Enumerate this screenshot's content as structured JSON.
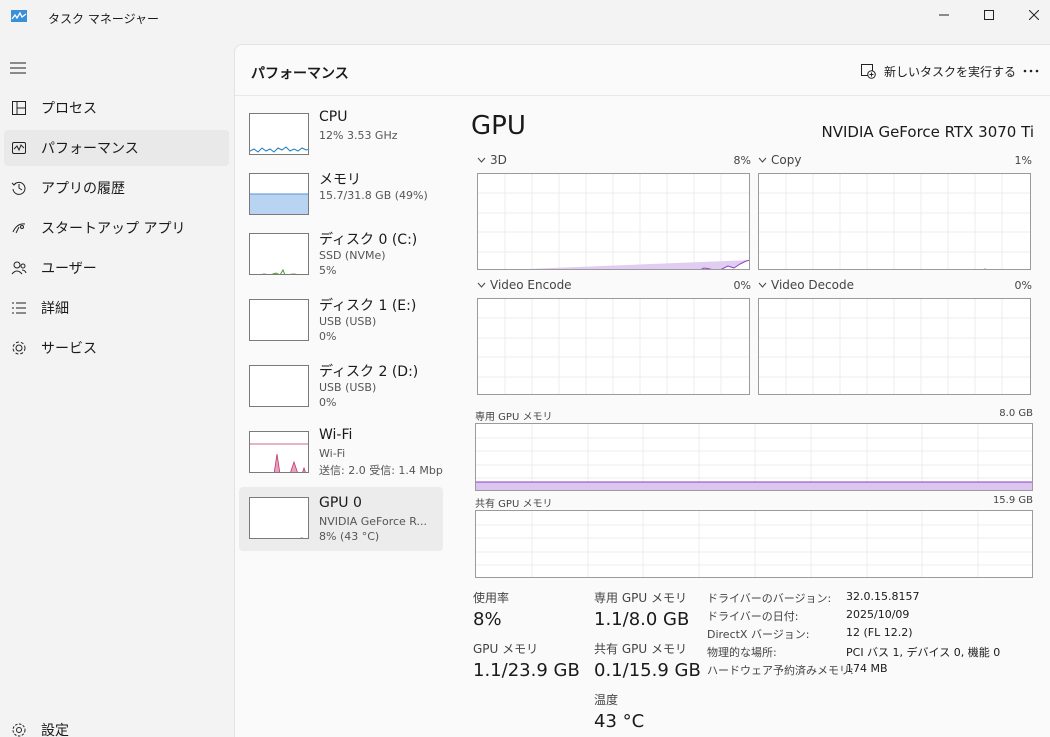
{
  "window": {
    "title": "タスク マネージャー"
  },
  "nav": {
    "items": [
      {
        "label": "プロセス",
        "icon": "processes-icon"
      },
      {
        "label": "パフォーマンス",
        "icon": "performance-icon",
        "active": true
      },
      {
        "label": "アプリの履歴",
        "icon": "history-icon"
      },
      {
        "label": "スタートアップ アプリ",
        "icon": "startup-icon"
      },
      {
        "label": "ユーザー",
        "icon": "users-icon"
      },
      {
        "label": "詳細",
        "icon": "details-icon"
      },
      {
        "label": "サービス",
        "icon": "services-icon"
      }
    ],
    "settings": "設定"
  },
  "header": {
    "title": "パフォーマンス",
    "run_task": "新しいタスクを実行する"
  },
  "devices": [
    {
      "name": "CPU",
      "sub1": "12%  3.53 GHz",
      "sub2": ""
    },
    {
      "name": "メモリ",
      "sub1": "15.7/31.8 GB (49%)",
      "sub2": ""
    },
    {
      "name": "ディスク 0 (C:)",
      "sub1": "SSD (NVMe)",
      "sub2": "5%"
    },
    {
      "name": "ディスク 1 (E:)",
      "sub1": "USB (USB)",
      "sub2": "0%"
    },
    {
      "name": "ディスク 2 (D:)",
      "sub1": "USB (USB)",
      "sub2": "0%"
    },
    {
      "name": "Wi-Fi",
      "sub1": "Wi-Fi",
      "sub2": "送信: 2.0  受信: 1.4 Mbps"
    },
    {
      "name": "GPU 0",
      "sub1": "NVIDIA GeForce R...",
      "sub2": "8% (43 °C)",
      "selected": true
    }
  ],
  "gpu": {
    "title": "GPU",
    "model": "NVIDIA GeForce RTX 3070 Ti",
    "engines": [
      {
        "label": "3D",
        "pct": "8%"
      },
      {
        "label": "Copy",
        "pct": "1%"
      },
      {
        "label": "Video Encode",
        "pct": "0%"
      },
      {
        "label": "Video Decode",
        "pct": "0%"
      }
    ],
    "dedicated_label": "専用 GPU メモリ",
    "dedicated_max": "8.0 GB",
    "shared_label": "共有 GPU メモリ",
    "shared_max": "15.9 GB",
    "stats": {
      "usage_label": "使用率",
      "usage": "8%",
      "ded_label": "専用 GPU メモリ",
      "ded": "1.1/8.0 GB",
      "gpumem_label": "GPU メモリ",
      "gpumem": "1.1/23.9 GB",
      "shared_label": "共有 GPU メモリ",
      "shared": "0.1/15.9 GB",
      "temp_label": "温度",
      "temp": "43 °C"
    },
    "info": [
      {
        "k": "ドライバーのバージョン:",
        "v": "32.0.15.8157"
      },
      {
        "k": "ドライバーの日付:",
        "v": "2025/10/09"
      },
      {
        "k": "DirectX バージョン:",
        "v": "12 (FL 12.2)"
      },
      {
        "k": "物理的な場所:",
        "v": "PCI バス 1, デバイス 0, 機能 0"
      },
      {
        "k": "ハードウェア予約済みメモリ:",
        "v": "174 MB"
      }
    ]
  },
  "colors": {
    "cpu": "#1a7fc1",
    "memory": "#5b8ed6",
    "disk": "#4c9a2a",
    "wifi": "#c0336b",
    "gpu": "#8b3fbf"
  }
}
